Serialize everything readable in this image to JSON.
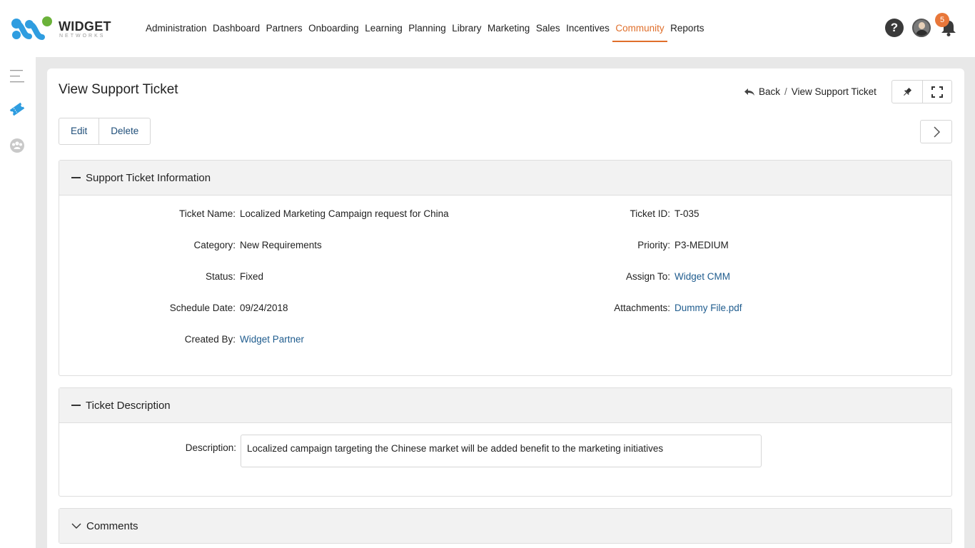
{
  "brand": {
    "name": "WIDGET",
    "tagline": "NETWORKS",
    "colors": {
      "blue": "#2f9de0",
      "green": "#6bb23a",
      "accent": "#e06f2b"
    }
  },
  "nav": {
    "items": [
      "Administration",
      "Dashboard",
      "Partners",
      "Onboarding",
      "Learning",
      "Planning",
      "Library",
      "Marketing",
      "Sales",
      "Incentives",
      "Community",
      "Reports"
    ],
    "active": "Community"
  },
  "header_icons": {
    "help": "help-icon",
    "profile": "avatar",
    "notifications": "bell-icon",
    "notification_count": "5"
  },
  "sidebar": {
    "icons": [
      "menu-icon",
      "ticket-icon",
      "community-icon"
    ]
  },
  "page": {
    "title": "View Support Ticket",
    "breadcrumb": {
      "back_label": "Back",
      "separator": "/",
      "current": "View Support Ticket"
    },
    "actions": {
      "edit_label": "Edit",
      "delete_label": "Delete"
    },
    "tools": [
      "pin-icon",
      "fullscreen-icon"
    ]
  },
  "info_panel": {
    "title": "Support Ticket Information",
    "left": [
      {
        "label": "Ticket Name:",
        "value": "Localized Marketing Campaign request for China",
        "link": false
      },
      {
        "label": "Category:",
        "value": "New Requirements",
        "link": false
      },
      {
        "label": "Status:",
        "value": "Fixed",
        "link": false
      },
      {
        "label": "Schedule Date:",
        "value": "09/24/2018",
        "link": false
      },
      {
        "label": "Created By:",
        "value": "Widget Partner",
        "link": true
      }
    ],
    "right": [
      {
        "label": "Ticket ID:",
        "value": "T-035",
        "link": false
      },
      {
        "label": "Priority:",
        "value": "P3-MEDIUM",
        "link": false
      },
      {
        "label": "Assign To:",
        "value": "Widget CMM",
        "link": true
      },
      {
        "label": "Attachments:",
        "value": "Dummy File.pdf",
        "link": true
      }
    ]
  },
  "description_panel": {
    "title": "Ticket Description",
    "label": "Description:",
    "value": "Localized campaign targeting the Chinese market will be added benefit to the marketing initiatives"
  },
  "comments_panel": {
    "title": "Comments"
  }
}
